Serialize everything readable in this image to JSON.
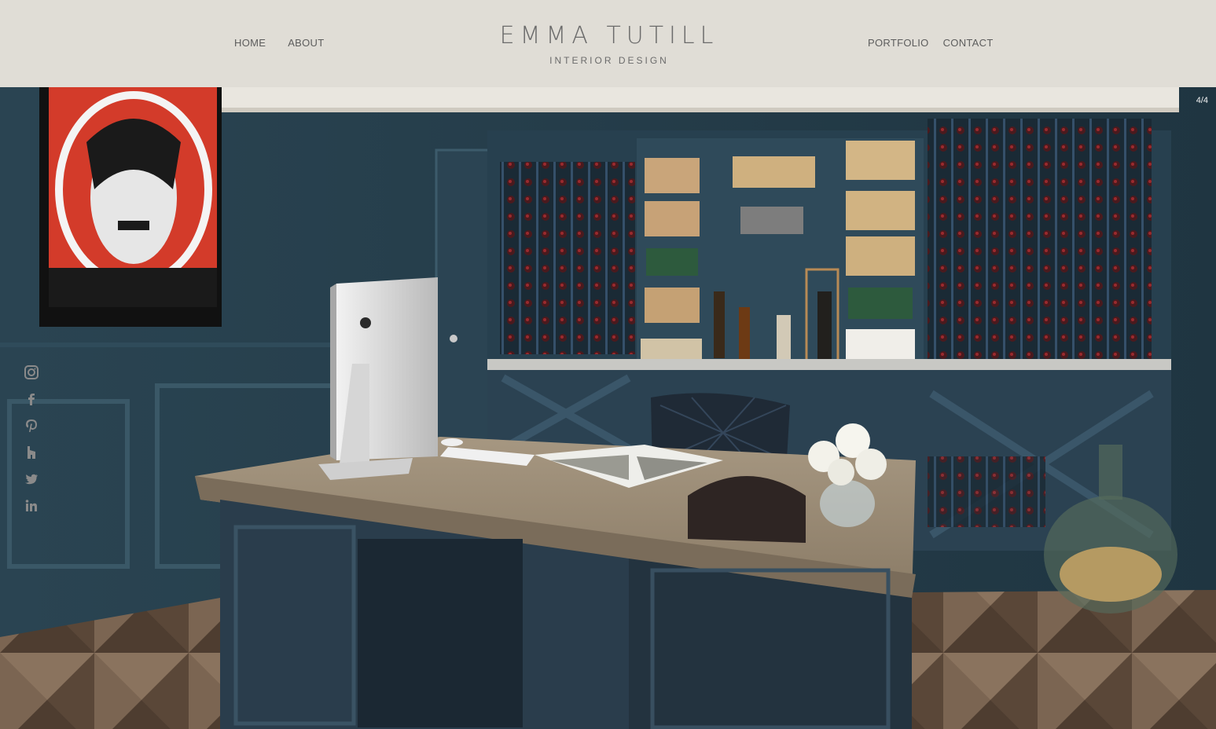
{
  "brand": {
    "title": "EMMA TUTILL",
    "subtitle": "INTERIOR DESIGN"
  },
  "nav": {
    "left": [
      "HOME",
      "ABOUT"
    ],
    "right": [
      "PORTFOLIO",
      "CONTACT"
    ]
  },
  "slideshow": {
    "counter": "4/4"
  },
  "social": [
    "instagram-icon",
    "facebook-icon",
    "pinterest-icon",
    "houzz-icon",
    "twitter-icon",
    "linkedin-icon"
  ],
  "colors": {
    "header_bg": "#e0ddd6",
    "nav_text": "#5d5d5d",
    "logo_text": "#6b6b6b",
    "wall": "#233a46",
    "cabinet": "#2c4150",
    "social_icon": "#8a8a8a"
  }
}
